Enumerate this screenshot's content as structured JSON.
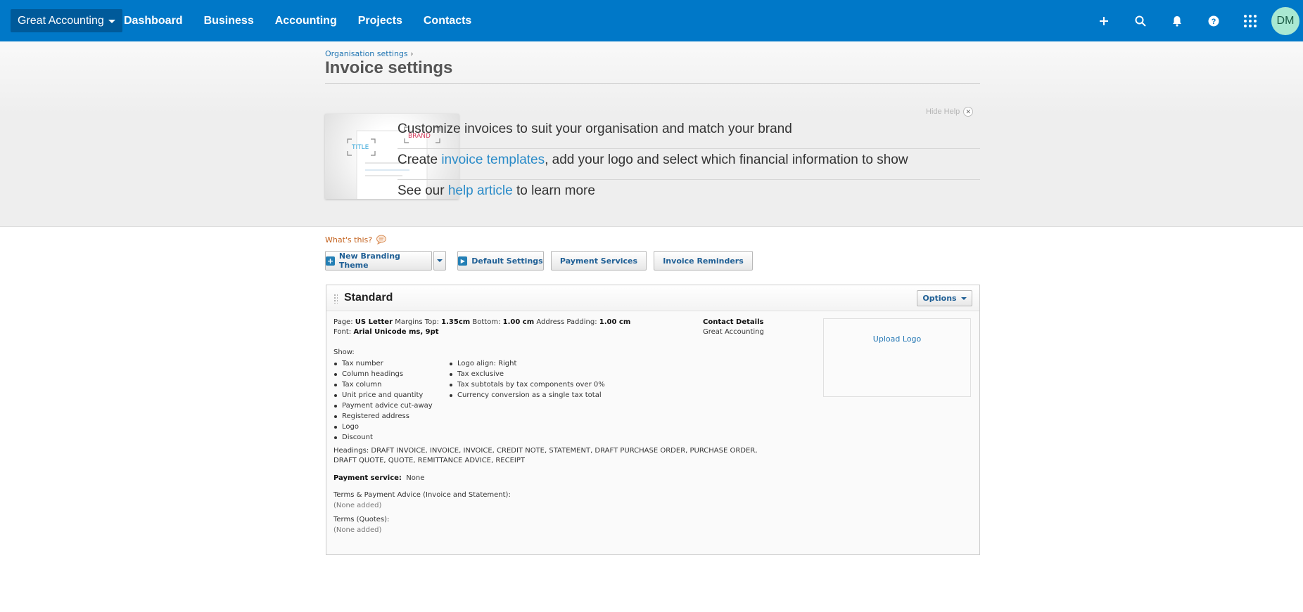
{
  "nav": {
    "org": "Great Accounting",
    "links": [
      "Dashboard",
      "Business",
      "Accounting",
      "Projects",
      "Contacts"
    ],
    "icons": [
      "plus-icon",
      "search-icon",
      "bell-icon",
      "help-icon",
      "apps-grid-icon"
    ],
    "avatar": "DM"
  },
  "header": {
    "breadcrumb": "Organisation settings",
    "breadcrumb_sep": "›",
    "title": "Invoice settings"
  },
  "help": {
    "hide_label": "Hide Help",
    "close_glyph": "✕",
    "illustration": {
      "title_label": "TITLE",
      "brand_label": "BRAND"
    },
    "line1": "Customize invoices to suit your organisation and match your brand",
    "line2_pre": "Create ",
    "line2_link": "invoice templates",
    "line2_post": ", add your logo and select which financial information to show",
    "line3_pre": "See our ",
    "line3_link": "help article",
    "line3_post": " to learn more"
  },
  "toolbar": {
    "whats_this": "What's this?",
    "new_theme": "New Branding Theme",
    "default_settings": "Default Settings",
    "payment_services": "Payment Services",
    "invoice_reminders": "Invoice Reminders"
  },
  "theme": {
    "name": "Standard",
    "options": "Options",
    "page_label": "Page:",
    "page_value": "US Letter",
    "margins_top_label": "Margins Top:",
    "margins_top_value": "1.35cm",
    "bottom_label": "Bottom:",
    "bottom_value": "1.00 cm",
    "padding_label": "Address Padding:",
    "padding_value": "1.00 cm",
    "font_label": "Font:",
    "font_value": "Arial Unicode ms, 9pt",
    "show_label": "Show:",
    "show_col1": [
      "Tax number",
      "Column headings",
      "Tax column",
      "Unit price and quantity",
      "Payment advice cut-away",
      "Registered address",
      "Logo",
      "Discount"
    ],
    "show_col2": [
      "Logo align: Right",
      "Tax exclusive",
      "Tax subtotals by tax components over 0%",
      "Currency conversion as a single tax total"
    ],
    "headings_line1": "Headings: DRAFT INVOICE, INVOICE, INVOICE, CREDIT NOTE, STATEMENT, DRAFT PURCHASE ORDER, PURCHASE ORDER,",
    "headings_line2": "DRAFT QUOTE, QUOTE, REMITTANCE ADVICE, RECEIPT",
    "payment_service_label": "Payment service:",
    "payment_service_value": "None",
    "terms_invoice_label": "Terms & Payment Advice (Invoice and Statement):",
    "terms_invoice_value": "(None added)",
    "terms_quotes_label": "Terms (Quotes):",
    "terms_quotes_value": "(None added)",
    "contact_title": "Contact Details",
    "contact_name": "Great Accounting",
    "upload_logo": "Upload Logo"
  }
}
